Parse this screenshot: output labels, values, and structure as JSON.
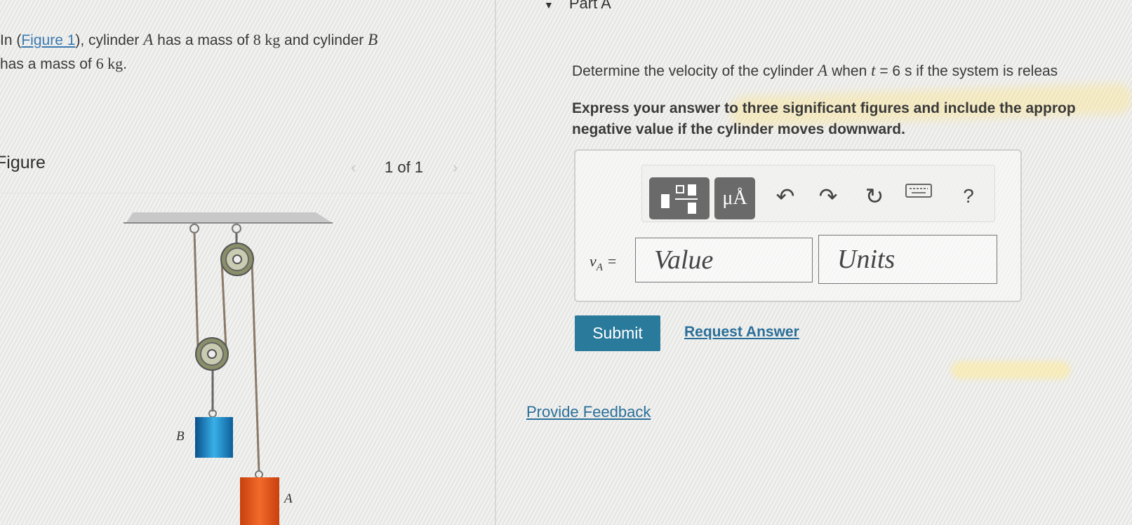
{
  "problem": {
    "prefix": "In (",
    "figure_link": "Figure 1",
    "suffix_1": "), cylinder ",
    "cyl_a": "A",
    "mid_1": " has a mass of ",
    "mass_a": "8 kg",
    "mid_2": " and cylinder ",
    "cyl_b": "B",
    "mid_3": " has a mass of ",
    "mass_b": "6 kg",
    "end": "."
  },
  "figure": {
    "heading": "Figure",
    "pager": "1 of 1",
    "prev_arrow": "‹",
    "next_arrow": "›",
    "label_a": "A",
    "label_b": "B",
    "cylinder_a_color": "#e0541c",
    "cylinder_b_color": "#1a86c8"
  },
  "part": {
    "title": "Part A",
    "question_1": "Determine the velocity of the cylinder ",
    "question_var": "A",
    "question_2": " when ",
    "question_t": "t",
    "question_3": " = 6 s if the system is releas",
    "instruction_1": "Express your answer to three significant figures and include the approp",
    "instruction_2": "negative value if the cylinder moves downward."
  },
  "toolbar": {
    "fraction_icon": "fraction-template-icon",
    "units_label": "μÅ",
    "undo_icon": "↶",
    "redo_icon": "↷",
    "reset_icon": "↻",
    "keyboard_icon": "keyboard-icon",
    "help_label": "?"
  },
  "answer": {
    "var_label": "v",
    "var_sub": "A",
    "equals": " =",
    "value_placeholder": "Value",
    "units_placeholder": "Units"
  },
  "actions": {
    "submit": "Submit",
    "request": "Request Answer",
    "feedback": "Provide Feedback"
  },
  "colors": {
    "accent": "#2a7a9c",
    "link": "#2a6f99"
  }
}
